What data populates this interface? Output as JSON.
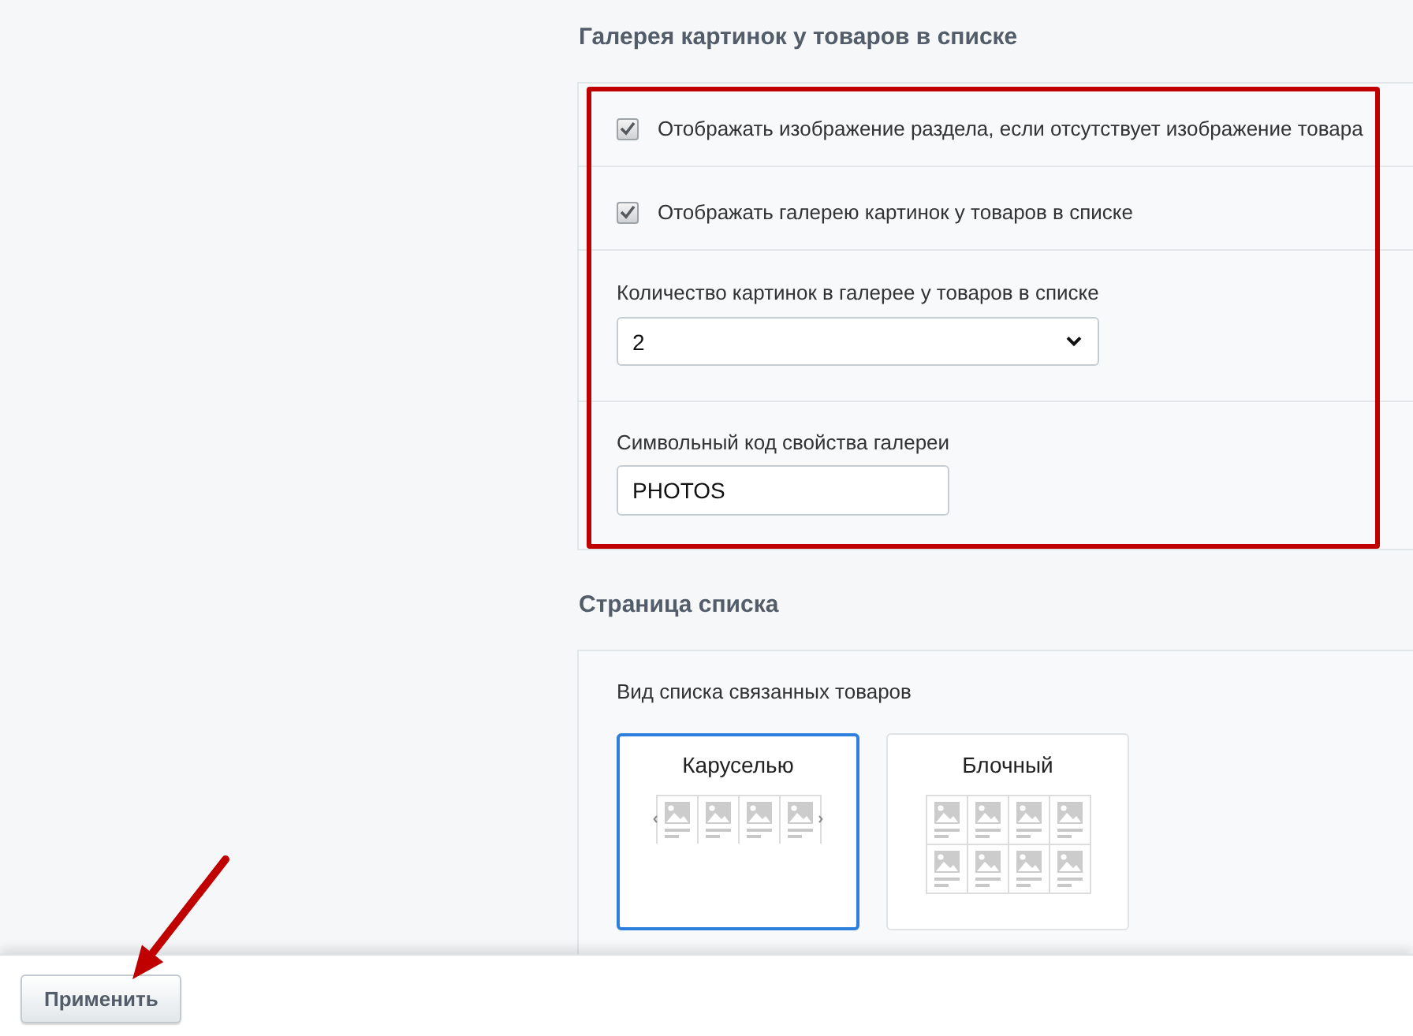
{
  "sections": [
    {
      "title": "Галерея картинок у товаров в списке",
      "highlighted": true,
      "rows": [
        {
          "kind": "checkbox",
          "label": "Отображать изображение раздела, если отсутствует изображение товара",
          "checked": true
        },
        {
          "kind": "checkbox",
          "label": "Отображать галерею картинок у товаров в списке",
          "checked": true
        },
        {
          "kind": "select",
          "label": "Количество картинок в галерее у товаров в списке",
          "value": "2"
        },
        {
          "kind": "text",
          "label": "Символьный код свойства галереи",
          "value": "PHOTOS"
        }
      ]
    },
    {
      "title": "Страница списка",
      "highlighted": false,
      "rows": [
        {
          "kind": "view_picker",
          "label": "Вид списка связанных товаров",
          "options": [
            {
              "kind": "carousel",
              "label": "Каруселью",
              "selected": true
            },
            {
              "kind": "grid",
              "label": "Блочный",
              "selected": false
            }
          ]
        }
      ]
    }
  ],
  "footer": {
    "buttons": [
      {
        "label": "Применить"
      }
    ]
  }
}
